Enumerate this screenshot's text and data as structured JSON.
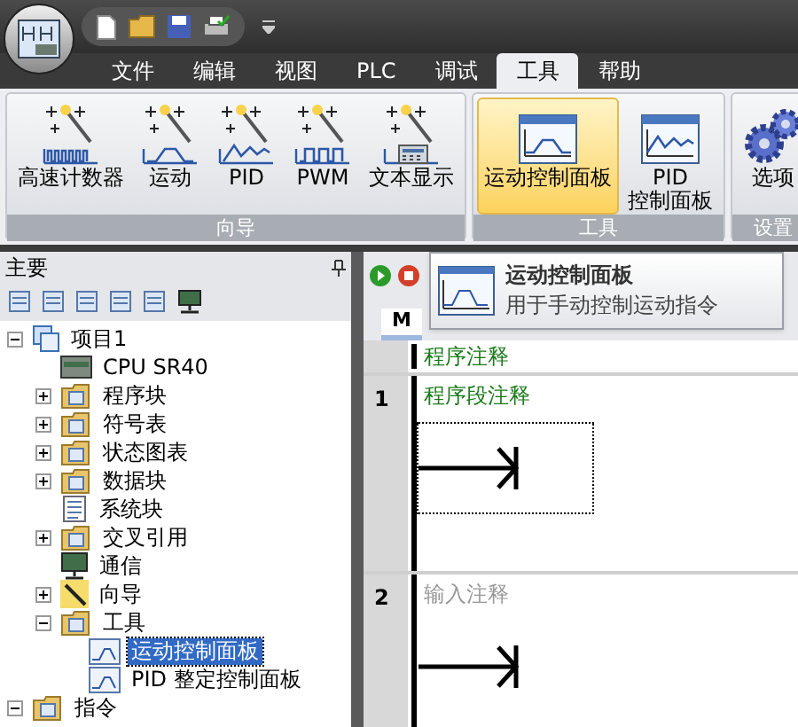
{
  "ribbon_tabs": [
    {
      "label": "文件",
      "selected": false
    },
    {
      "label": "编辑",
      "selected": false
    },
    {
      "label": "视图",
      "selected": false
    },
    {
      "label": "PLC",
      "selected": false
    },
    {
      "label": "调试",
      "selected": false
    },
    {
      "label": "工具",
      "selected": true
    },
    {
      "label": "帮助",
      "selected": false
    }
  ],
  "ribbon_groups": [
    {
      "label": "向导",
      "items": [
        {
          "kind": "counter",
          "lines": [
            "高速计数器"
          ],
          "selected": false
        },
        {
          "kind": "motion",
          "lines": [
            "运动"
          ],
          "selected": false
        },
        {
          "kind": "pid",
          "lines": [
            "PID"
          ],
          "selected": false
        },
        {
          "kind": "pwm",
          "lines": [
            "PWM"
          ],
          "selected": false
        },
        {
          "kind": "display",
          "lines": [
            "文本显示"
          ],
          "selected": false
        }
      ]
    },
    {
      "label": "工具",
      "items": [
        {
          "kind": "motionpanel",
          "lines": [
            "运动控制面板"
          ],
          "selected": true
        },
        {
          "kind": "pidpanel",
          "lines": [
            "PID",
            "控制面板"
          ],
          "selected": false
        }
      ]
    },
    {
      "label": "设置",
      "items": [
        {
          "kind": "options",
          "lines": [
            "选项"
          ],
          "selected": false
        }
      ]
    }
  ],
  "left_panel": {
    "title": "主要",
    "tree": [
      {
        "label": "项目1",
        "kind": "project",
        "expanded": true,
        "selected": false,
        "children": [
          {
            "label": "CPU SR40",
            "kind": "cpu",
            "selected": false
          },
          {
            "label": "程序块",
            "kind": "folder",
            "expanded": false,
            "selected": false
          },
          {
            "label": "符号表",
            "kind": "folder",
            "expanded": false,
            "selected": false
          },
          {
            "label": "状态图表",
            "kind": "folder",
            "expanded": false,
            "selected": false
          },
          {
            "label": "数据块",
            "kind": "folder",
            "expanded": false,
            "selected": false
          },
          {
            "label": "系统块",
            "kind": "doc",
            "selected": false
          },
          {
            "label": "交叉引用",
            "kind": "folder",
            "expanded": false,
            "selected": false
          },
          {
            "label": "通信",
            "kind": "comm",
            "selected": false
          },
          {
            "label": "向导",
            "kind": "wizard",
            "expanded": false,
            "selected": false
          },
          {
            "label": "工具",
            "kind": "folder",
            "expanded": true,
            "selected": false,
            "children": [
              {
                "label": "运动控制面板",
                "kind": "panel",
                "selected": true
              },
              {
                "label": "PID 整定控制面板",
                "kind": "panel",
                "selected": false
              }
            ]
          }
        ]
      },
      {
        "label": "指令",
        "kind": "folder",
        "expanded": true,
        "selected": false
      }
    ]
  },
  "program_tabs": [
    {
      "label": "M",
      "selected": true
    }
  ],
  "tooltip": {
    "title": "运动控制面板",
    "description": "用于手动控制运动指令"
  },
  "editor": {
    "program_comment": "程序注释",
    "networks": [
      {
        "number": "1",
        "comment": "程序段注释",
        "selected": true
      },
      {
        "number": "2",
        "placeholder": "输入注释",
        "selected": false
      }
    ]
  }
}
